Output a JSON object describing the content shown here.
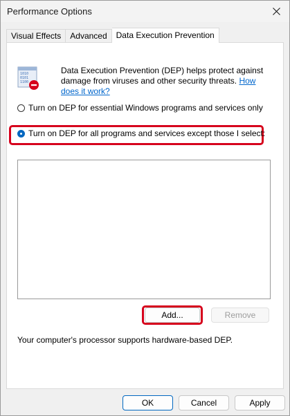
{
  "window": {
    "title": "Performance Options"
  },
  "tabs": [
    {
      "label": "Visual Effects",
      "active": false
    },
    {
      "label": "Advanced",
      "active": false
    },
    {
      "label": "Data Execution Prevention",
      "active": true
    }
  ],
  "dep": {
    "description": "Data Execution Prevention (DEP) helps protect against damage from viruses and other security threats.",
    "link_text": "How does it work?",
    "option_essential": "Turn on DEP for essential Windows programs and services only",
    "option_all": "Turn on DEP for all programs and services except those I select:",
    "selected_option": "all",
    "program_list": [],
    "add_button": "Add...",
    "remove_button": "Remove",
    "support_text": "Your computer's processor supports hardware-based DEP."
  },
  "footer": {
    "ok": "OK",
    "cancel": "Cancel",
    "apply": "Apply"
  },
  "colors": {
    "accent": "#0067c0",
    "highlight": "#d6001c",
    "link": "#0066cc"
  },
  "icons": {
    "dep_icon": "shield-binary-icon",
    "close_icon": "close-icon"
  }
}
